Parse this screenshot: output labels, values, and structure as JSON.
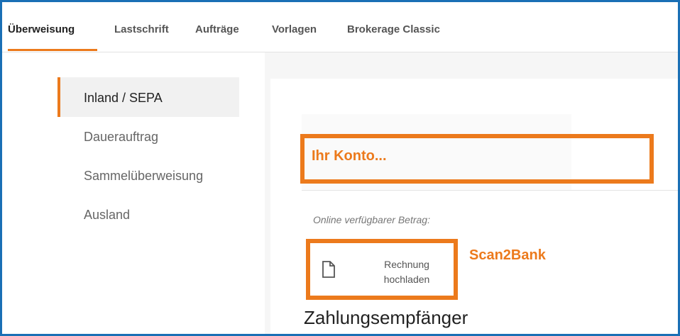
{
  "topnav": {
    "tabs": [
      {
        "label": "Überweisung"
      },
      {
        "label": "Lastschrift"
      },
      {
        "label": "Aufträge"
      },
      {
        "label": "Vorlagen"
      },
      {
        "label": "Brokerage Classic"
      }
    ]
  },
  "sidebar": {
    "items": [
      {
        "label": "Inland / SEPA"
      },
      {
        "label": "Dauerauftrag"
      },
      {
        "label": "Sammelüberweisung"
      },
      {
        "label": "Ausland"
      }
    ]
  },
  "main": {
    "account_label": "Ihr Konto...",
    "available_label": "Online verfügbarer Betrag:",
    "upload_button": {
      "line1": "Rechnung",
      "line2": "hochladen",
      "icon": "document-icon"
    },
    "scan2bank_label": "Scan2Bank",
    "section_title": "Zahlungsempfänger"
  },
  "colors": {
    "accent": "#ec7a1c",
    "frame": "#1a6fb5"
  }
}
